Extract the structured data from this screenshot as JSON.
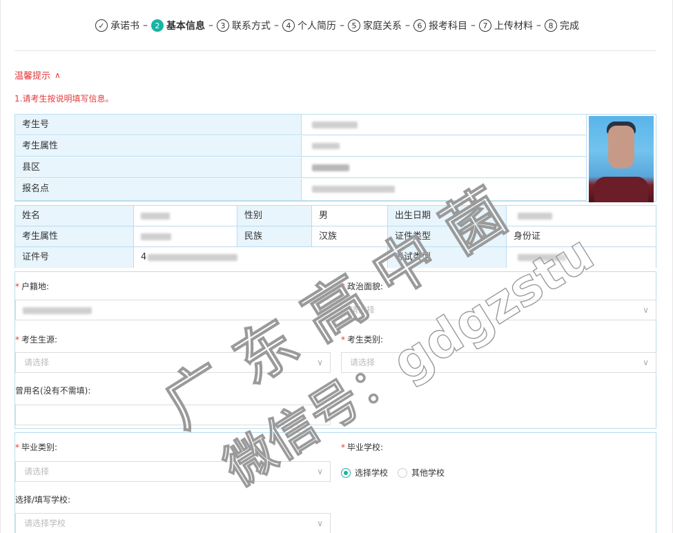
{
  "stepper": {
    "steps": [
      {
        "num": "✓",
        "label": "承诺书",
        "state": "done"
      },
      {
        "num": "2",
        "label": "基本信息",
        "state": "active"
      },
      {
        "num": "3",
        "label": "联系方式",
        "state": "todo"
      },
      {
        "num": "4",
        "label": "个人简历",
        "state": "todo"
      },
      {
        "num": "5",
        "label": "家庭关系",
        "state": "todo"
      },
      {
        "num": "6",
        "label": "报考科目",
        "state": "todo"
      },
      {
        "num": "7",
        "label": "上传材料",
        "state": "todo"
      },
      {
        "num": "8",
        "label": "完成",
        "state": "todo"
      }
    ],
    "separator": "–",
    "active_color": "#17b3a3"
  },
  "tip": {
    "title": "温馨提示",
    "toggle_icon": "chevron-up-icon",
    "line1": "1.请考生按说明填写信息。",
    "color": "#e4393c"
  },
  "info_table": {
    "rows": [
      {
        "label": "考生号"
      },
      {
        "label": "考生属性"
      },
      {
        "label": "县区"
      },
      {
        "label": "报名点"
      }
    ]
  },
  "detail_table": {
    "row1": {
      "name_label": "姓名",
      "gender_label": "性别",
      "gender_value": "男",
      "birth_label": "出生日期"
    },
    "row2": {
      "attr_label": "考生属性",
      "ethnic_label": "民族",
      "ethnic_value": "汉族",
      "idtype_label": "证件类型",
      "idtype_value": "身份证"
    },
    "row3": {
      "idno_label": "证件号",
      "idno_value": "4",
      "examtype_label": "考试类型"
    }
  },
  "form1": {
    "hukou_label": "户籍地:",
    "politics_label": "政治面貌:",
    "politics_placeholder": "请选择",
    "source_label": "考生生源:",
    "source_placeholder": "请选择",
    "category_label": "考生类别:",
    "category_placeholder": "请选择",
    "former_name_label": "曾用名(没有不需填):"
  },
  "form2": {
    "grad_type_label": "毕业类别:",
    "grad_type_placeholder": "请选择",
    "grad_school_label": "毕业学校:",
    "radio_select": "选择学校",
    "radio_other": "其他学校",
    "school_input_label": "选择/填写学校:",
    "school_placeholder": "请选择学校"
  },
  "watermark": {
    "line1": "广 东 高 中 菌",
    "line2": "微信号：gdgzstu"
  }
}
